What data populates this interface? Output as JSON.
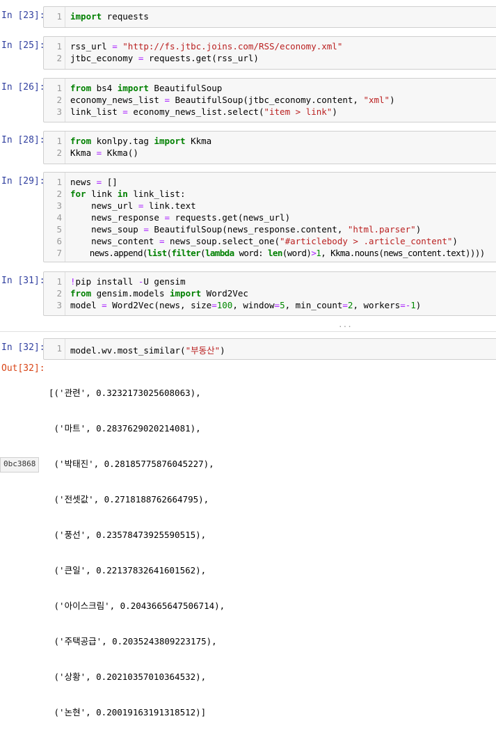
{
  "cells": [
    {
      "prompt": "In [23]:",
      "lines": [
        "import requests"
      ]
    },
    {
      "prompt": "In [25]:",
      "lines": [
        "rss_url = \"http://fs.jtbc.joins.com/RSS/economy.xml\"",
        "jtbc_economy = requests.get(rss_url)"
      ]
    },
    {
      "prompt": "In [26]:",
      "lines": [
        "from bs4 import BeautifulSoup",
        "economy_news_list = BeautifulSoup(jtbc_economy.content, \"xml\")",
        "link_list = economy_news_list.select(\"item > link\")"
      ]
    },
    {
      "prompt": "In [28]:",
      "lines": [
        "from konlpy.tag import Kkma",
        "Kkma = Kkma()"
      ]
    },
    {
      "prompt": "In [29]:",
      "lines": [
        "news = []",
        "for link in link_list:",
        "    news_url = link.text",
        "    news_response = requests.get(news_url)",
        "    news_soup = BeautifulSoup(news_response.content, \"html.parser\")",
        "    news_content = news_soup.select_one(\"#articlebody > .article_content\")",
        "    news.append(list(filter(lambda word: len(word)>1, Kkma.nouns(news_content.text))))"
      ]
    },
    {
      "prompt": "In [31]:",
      "lines": [
        "!pip install -U gensim",
        "from gensim.models import Word2Vec",
        "model = Word2Vec(news, size=100, window=5, min_count=2, workers=-1)"
      ]
    },
    {
      "prompt": "In [32]:",
      "lines": [
        "model.wv.most_similar(\"부동산\")"
      ]
    }
  ],
  "ellipsis": "...",
  "output": {
    "prompt": "Out[32]:",
    "lines": [
      "[('관련', 0.3232173025608063),",
      " ('마트', 0.2837629020214081),",
      " ('박태진', 0.28185775876045227),",
      " ('전셋값', 0.2718188762664795),",
      " ('풍선', 0.23578473925590515),",
      " ('큰일', 0.22137832641601562),",
      " ('아이스크림', 0.2043665647506714),",
      " ('주택공급', 0.2035243809223175),",
      " ('상황', 0.20210357010364532),",
      " ('논현', 0.20019163191318512)]"
    ]
  },
  "side_chip": "0bc3868"
}
